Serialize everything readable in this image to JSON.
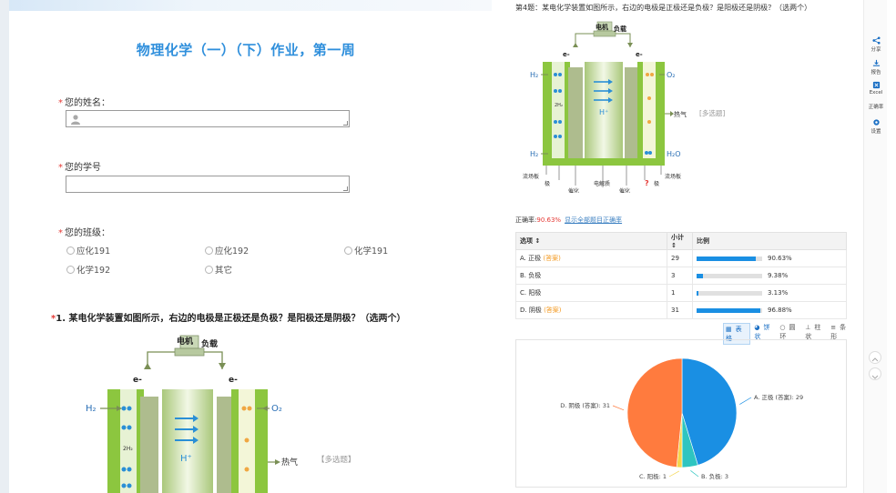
{
  "form": {
    "title": "物理化学（一）（下）作业，第一周",
    "name_label": "您的姓名：",
    "student_id_label": "您的学号",
    "class_label": "您的班级：",
    "class_options": [
      "应化191",
      "应化192",
      "化学191",
      "化学192",
      "其它"
    ],
    "q1_title": "1. 某电化学装置如图所示，右边的电极是正极还是负极？是阳极还是阴极？（选两个）",
    "q1_type_tag": "【多选题】"
  },
  "diagram": {
    "motor_label": "电机",
    "load_label": "负载",
    "electron_left": "e-",
    "electron_right": "e-",
    "h2_label": "H₂",
    "o2_label": "O₂",
    "h2o_label": "H₂O",
    "proton_label": "H⁺",
    "heat_label": "热气",
    "small_h2": "2H₂",
    "flow_plate_left": "流场板",
    "flow_plate_right": "流场板",
    "electrode_left": "极",
    "electrode_right": "极",
    "catalyst_left": "催化",
    "catalyst_right": "催化",
    "membrane": "电解质",
    "question_mark": "?"
  },
  "results": {
    "q4_title": "第4题：某电化学装置如图所示，右边的电极是正极还是负极？是阳极还是阴极？（选两个）",
    "q4_type_tag": "[多选题]",
    "accuracy_label": "正确率:",
    "accuracy_value": "90.63%",
    "show_all_link": "显示全部题目正确率",
    "columns": [
      "选项",
      "小计",
      "比例"
    ],
    "rows": [
      {
        "option": "A. 正极",
        "tag": "(答案)",
        "count": "29",
        "pct": "90.63%",
        "fill": 0.9063
      },
      {
        "option": "B. 负极",
        "tag": "",
        "count": "3",
        "pct": "9.38%",
        "fill": 0.0938
      },
      {
        "option": "C. 阳极",
        "tag": "",
        "count": "1",
        "pct": "3.13%",
        "fill": 0.0313
      },
      {
        "option": "D. 阴极",
        "tag": "(答案)",
        "count": "31",
        "pct": "96.88%",
        "fill": 0.9688
      }
    ],
    "view_tabs": [
      "表格",
      "饼状",
      "圆环",
      "柱状",
      "条形"
    ],
    "active_tab": "饼状"
  },
  "chart_data": {
    "type": "pie",
    "categories": [
      "A. 正极 (答案)",
      "B. 负极",
      "C. 阳极",
      "D. 阴极 (答案)"
    ],
    "values": [
      29,
      3,
      1,
      31
    ],
    "labels": [
      "A. 正极 (答案): 29",
      "B. 负极: 3",
      "C. 阳极: 1",
      "D. 阴极 (答案): 31"
    ],
    "colors": [
      "#1a8fe3",
      "#2ec5c0",
      "#f5d54a",
      "#ff7b3e"
    ]
  },
  "toolbar": {
    "share": "分享",
    "download": "报告",
    "excel": "Excel",
    "correct": "正确率",
    "settings": "设置"
  },
  "colors": {
    "accent": "#2f8fdc",
    "required": "#e53935",
    "bar": "#1a8fe3"
  }
}
